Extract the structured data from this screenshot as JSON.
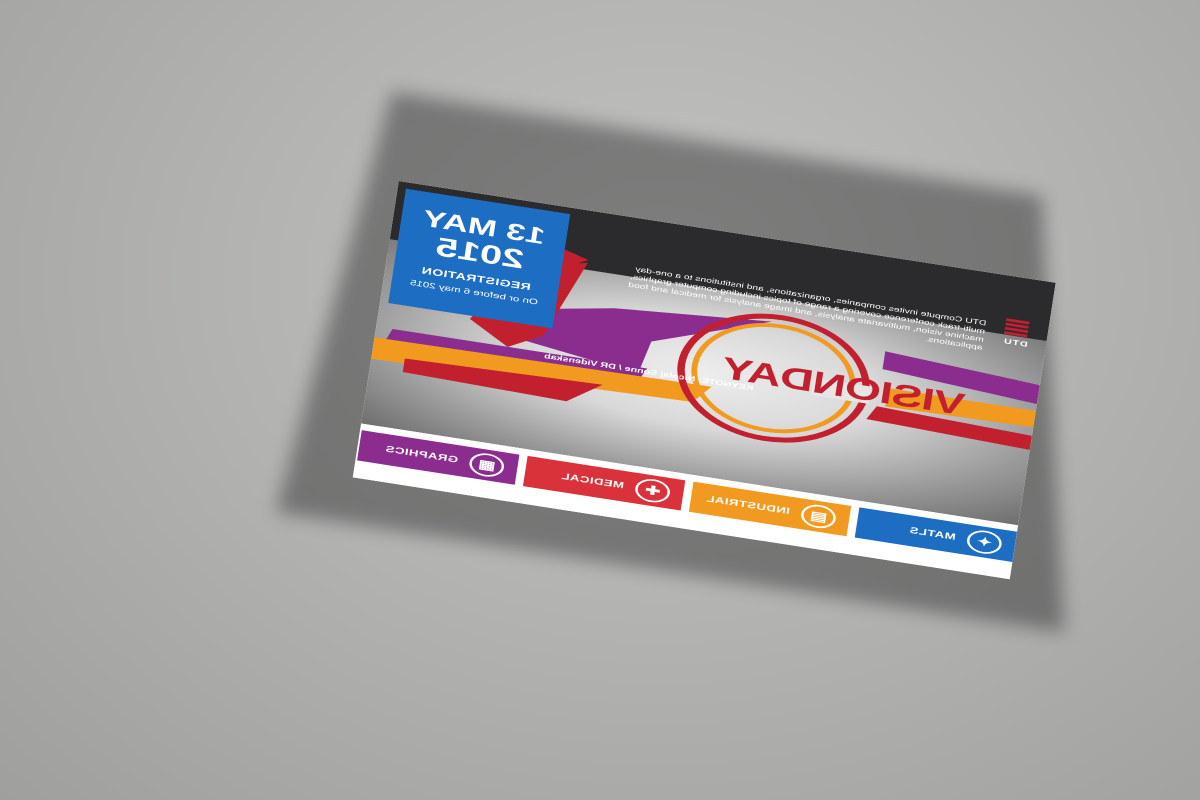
{
  "flyer": {
    "organizer": {
      "logo_text": "DTU",
      "intro": "DTU Compute invites companies, organizations, and institutions to a one-day multi-track conference covering a range of topics including computer graphics, machine vision, multivariate analysis, and image analysis for medical and food applications."
    },
    "event": {
      "logo_text": "VISIONDAY",
      "keynote": "KEYNOTE: Nicolaj Sonne / DR Videnskab"
    },
    "registration": {
      "date_line1": "13 MAY",
      "date_line2": "2015",
      "label": "REGISTRATION",
      "deadline": "On or before 6 may 2015"
    },
    "tracks": [
      {
        "label": "MATLS",
        "icon": "leaf-icon",
        "color": "#1d6ec2"
      },
      {
        "label": "INDUSTRIAL",
        "icon": "factory-icon",
        "color": "#f29a1f"
      },
      {
        "label": "MEDICAL",
        "icon": "medical-cross-icon",
        "color": "#d9323a"
      },
      {
        "label": "GRAPHICS",
        "icon": "pixel-grid-icon",
        "color": "#8b2d8f"
      }
    ],
    "colors": {
      "red": "#c2202f",
      "orange": "#f29a1f",
      "purple": "#8b2d8f",
      "blue": "#1d6ec2",
      "dark": "#2b2a2c"
    }
  }
}
